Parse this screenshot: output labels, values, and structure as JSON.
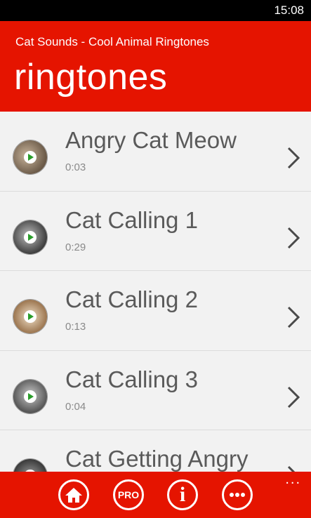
{
  "status": {
    "time": "15:08"
  },
  "header": {
    "app_name": "Cat Sounds - Cool Animal Ringtones",
    "page_title": "ringtones"
  },
  "ringtones": [
    {
      "title": "Angry Cat Meow",
      "duration": "0:03",
      "thumb_color": "#8c7b6b"
    },
    {
      "title": "Cat Calling 1",
      "duration": "0:29",
      "thumb_color": "#6e6e6e"
    },
    {
      "title": "Cat Calling 2",
      "duration": "0:13",
      "thumb_color": "#b8946a"
    },
    {
      "title": "Cat Calling 3",
      "duration": "0:04",
      "thumb_color": "#7d7d7d"
    },
    {
      "title": "Cat Getting Angry",
      "duration": "",
      "thumb_color": "#5e5e5e"
    }
  ],
  "app_bar": {
    "buttons": [
      {
        "icon": "home-icon"
      },
      {
        "label": "PRO"
      },
      {
        "label": "i"
      },
      {
        "icon": "more-horizontal-icon"
      }
    ],
    "more_label": "..."
  },
  "colors": {
    "accent": "#e51400",
    "play": "#2a9d2a"
  }
}
